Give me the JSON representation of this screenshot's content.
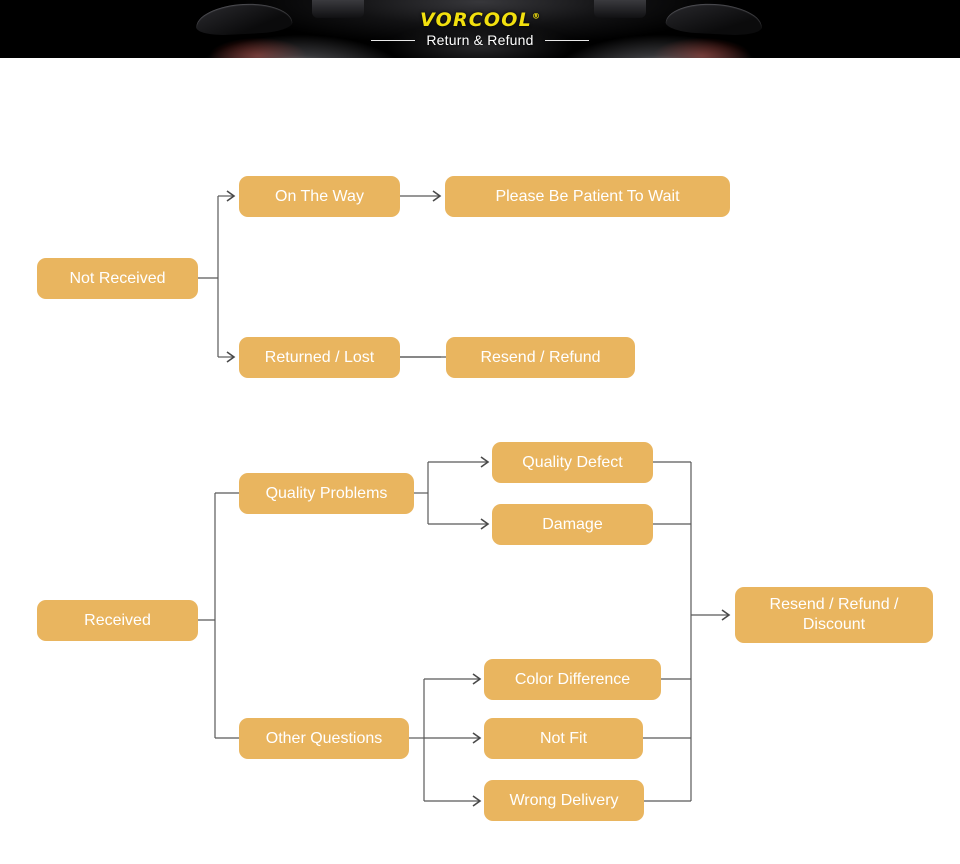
{
  "banner": {
    "brand": "VORCOOL",
    "trademark": "®",
    "subtitle": "Return & Refund",
    "background_color": "#000000",
    "brand_color": "#f2e00e",
    "subtitle_color": "#ffffff"
  },
  "theme": {
    "node_fill": "#e9b55f",
    "node_text": "#ffffff",
    "connector_color": "#595959",
    "page_background": "#ffffff"
  },
  "flow": {
    "nodes": {
      "not_received": "Not Received",
      "on_the_way": "On The Way",
      "please_be_patient": "Please Be Patient To Wait",
      "returned_lost": "Returned / Lost",
      "resend_refund": "Resend / Refund",
      "received": "Received",
      "quality_problems": "Quality Problems",
      "other_questions": "Other Questions",
      "quality_defect": "Quality Defect",
      "damage": "Damage",
      "color_difference": "Color Difference",
      "not_fit": "Not Fit",
      "wrong_delivery": "Wrong Delivery",
      "resend_refund_discount": "Resend / Refund /\nDiscount"
    },
    "edges": [
      {
        "from": "not_received",
        "to": "on_the_way",
        "arrow": true
      },
      {
        "from": "not_received",
        "to": "returned_lost",
        "arrow": true
      },
      {
        "from": "on_the_way",
        "to": "please_be_patient",
        "arrow": true
      },
      {
        "from": "returned_lost",
        "to": "resend_refund",
        "arrow": true
      },
      {
        "from": "received",
        "to": "quality_problems",
        "arrow": false
      },
      {
        "from": "received",
        "to": "other_questions",
        "arrow": false
      },
      {
        "from": "quality_problems",
        "to": "quality_defect",
        "arrow": true
      },
      {
        "from": "quality_problems",
        "to": "damage",
        "arrow": true
      },
      {
        "from": "other_questions",
        "to": "color_difference",
        "arrow": true
      },
      {
        "from": "other_questions",
        "to": "not_fit",
        "arrow": true
      },
      {
        "from": "other_questions",
        "to": "wrong_delivery",
        "arrow": true
      },
      {
        "from": "quality_defect",
        "to": "resend_refund_discount",
        "arrow": true
      },
      {
        "from": "damage",
        "to": "resend_refund_discount",
        "arrow": true
      },
      {
        "from": "color_difference",
        "to": "resend_refund_discount",
        "arrow": true
      },
      {
        "from": "not_fit",
        "to": "resend_refund_discount",
        "arrow": true
      },
      {
        "from": "wrong_delivery",
        "to": "resend_refund_discount",
        "arrow": true
      }
    ]
  }
}
